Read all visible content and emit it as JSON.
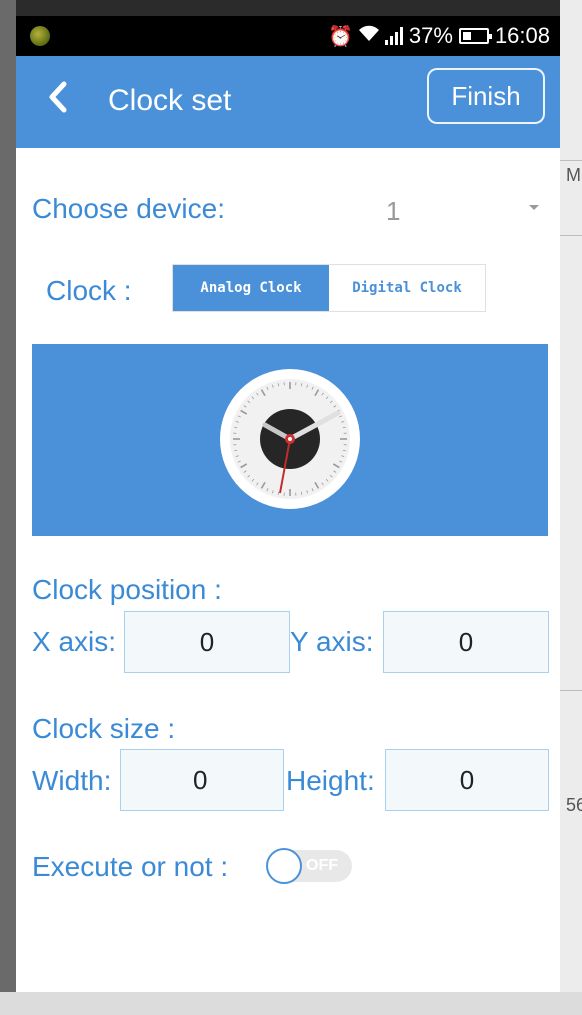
{
  "status_bar": {
    "battery_percent": "37%",
    "time": "16:08",
    "battery_level": 0.37,
    "icons": [
      "alarm-icon",
      "wifi-icon",
      "signal-icon",
      "battery-icon"
    ]
  },
  "app_bar": {
    "back_glyph": "‹",
    "title": "Clock set",
    "finish_label": "Finish"
  },
  "form": {
    "choose_device_label": "Choose device:",
    "device_value": "1",
    "clock_label": "Clock :",
    "clock_types": [
      {
        "label": "Analog Clock",
        "selected": true
      },
      {
        "label": "Digital Clock",
        "selected": false
      }
    ],
    "position_label": "Clock position :",
    "x_axis_label": "X axis:",
    "x_value": "0",
    "y_axis_label": "Y axis:",
    "y_value": "0",
    "size_label": "Clock size :",
    "width_label": "Width:",
    "width_value": "0",
    "height_label": "Height:",
    "height_value": "0",
    "execute_label": "Execute or not :",
    "execute_toggle": "OFF"
  },
  "colors": {
    "accent": "#4a91d9",
    "label_blue": "#3a8ad6"
  }
}
